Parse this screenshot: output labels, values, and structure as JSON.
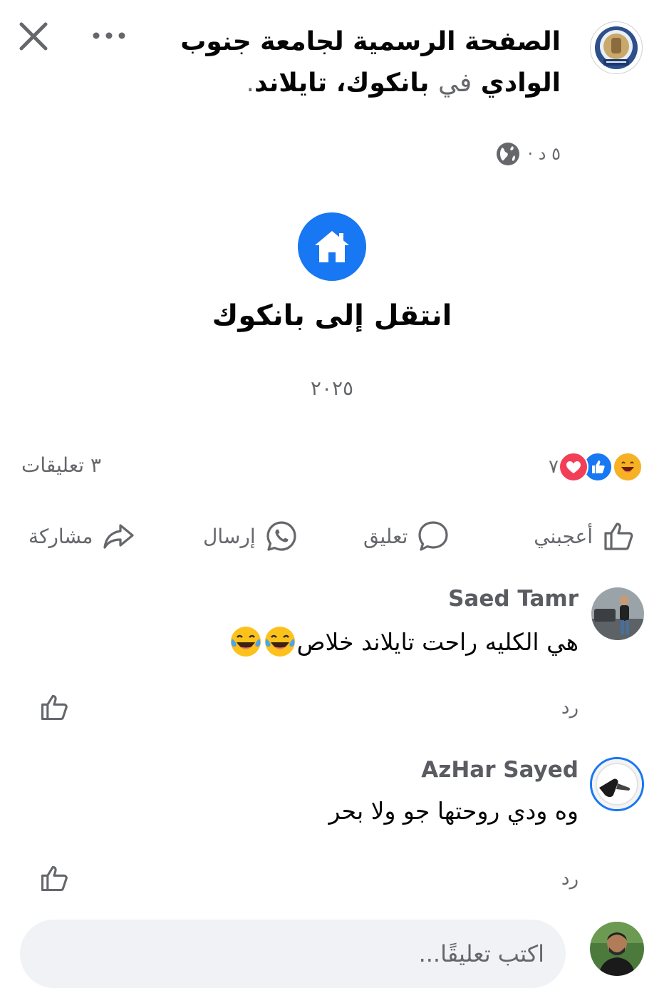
{
  "header": {
    "page_name": "الصفحة الرسمية لجامعة جنوب الوادي",
    "in_word": "في",
    "location": "بانكوك، تايلاند",
    "period": ".",
    "time": "٥ د ·",
    "privacy_icon": "globe-icon"
  },
  "event": {
    "icon": "home-icon",
    "title": "انتقل إلى بانكوك",
    "year": "٢٠٢٥"
  },
  "reactions": {
    "types": [
      "haha",
      "like",
      "love"
    ],
    "count": "٧",
    "comments_count": "٣ تعليقات"
  },
  "actions": {
    "like": "أعجبني",
    "comment": "تعليق",
    "send": "إرسال",
    "share": "مشاركة"
  },
  "comments": [
    {
      "author": "Saed Tamr",
      "text": "هي الكليه راحت تايلاند خلاص",
      "emoji": [
        "laughing-tears",
        "laughing-tears"
      ],
      "reply": "رد"
    },
    {
      "author": "AzHar Sayed",
      "text": "وه ودي روحتها جو ولا بحر",
      "reply": "رد"
    }
  ],
  "composer": {
    "placeholder": "اكتب تعليقًا..."
  },
  "colors": {
    "facebook_blue": "#1877f2",
    "love_red": "#f33e58",
    "haha_yellow": "#f7b125",
    "secondary_text": "#65676b",
    "input_bg": "#f0f2f5"
  }
}
